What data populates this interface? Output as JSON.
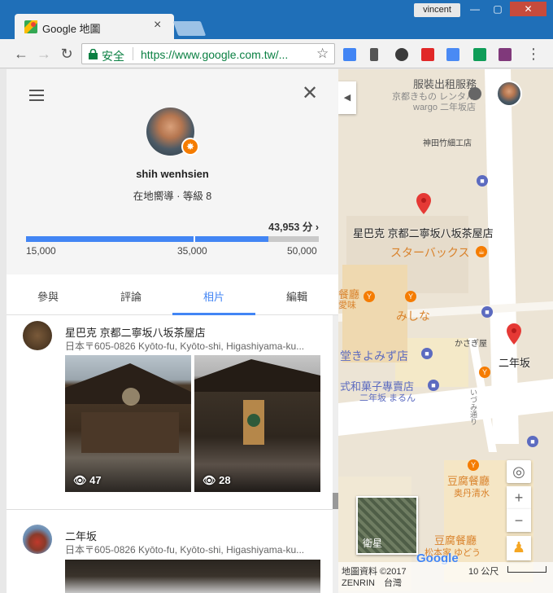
{
  "browser": {
    "tab_title": "Google 地圖",
    "user_name": "vincent",
    "secure_label": "安全",
    "url": "https://www.google.com.tw/..."
  },
  "panel": {
    "user_name": "shih wenhsien",
    "user_level": "在地嚮導 · 等級 8",
    "points": "43,953 分",
    "progress": {
      "min": 15000,
      "mid": 35000,
      "max": 50000,
      "value": 43953
    },
    "ticks": [
      "15,000",
      "35,000",
      "50,000"
    ],
    "tabs": [
      "參與",
      "評論",
      "相片",
      "編輯"
    ],
    "active_tab": "相片",
    "entries": [
      {
        "title": "星巴克 京都二寧坂八坂茶屋店",
        "address": "日本〒605-0826 Kyōto-fu, Kyōto-shi, Higashiyama-ku...",
        "photos": [
          {
            "count": "47"
          },
          {
            "count": "28"
          }
        ]
      },
      {
        "title": "二年坂",
        "address": "日本〒605-0826 Kyōto-fu, Kyōto-shi, Higashiyama-ku..."
      }
    ]
  },
  "map": {
    "labels": {
      "rental": "服裝出租服務",
      "rental_sub": "京都きもの レンタル",
      "rental_sub2": "wargo 二年坂店",
      "bamboo": "神田竹細工店",
      "starbucks": "星巴克 京都二寧坂八坂茶屋店",
      "starbucks_jp": "スターバックス",
      "restaurant": "餐廳",
      "restaurant_sub": "愛味",
      "mishina": "みしな",
      "kasagiya": "かさぎ屋",
      "yomizu": "堂きよみず店",
      "wagashi": "式和菓子專賣店",
      "wagashi_sub": "二年坂 まるん",
      "ninenzaka": "二年坂",
      "tofu": "豆腐餐廳",
      "tofu_sub": "奥丹清水",
      "tofu2": "豆腐餐廳",
      "tofu2_sub": "松本家 ゆどう",
      "street": "いづみ通り",
      "satellite": "衛星",
      "copyright": "地圖資料 ©2017",
      "copyright2": "ZENRIN　台灣",
      "scale": "10 公尺",
      "google": "Google"
    }
  }
}
